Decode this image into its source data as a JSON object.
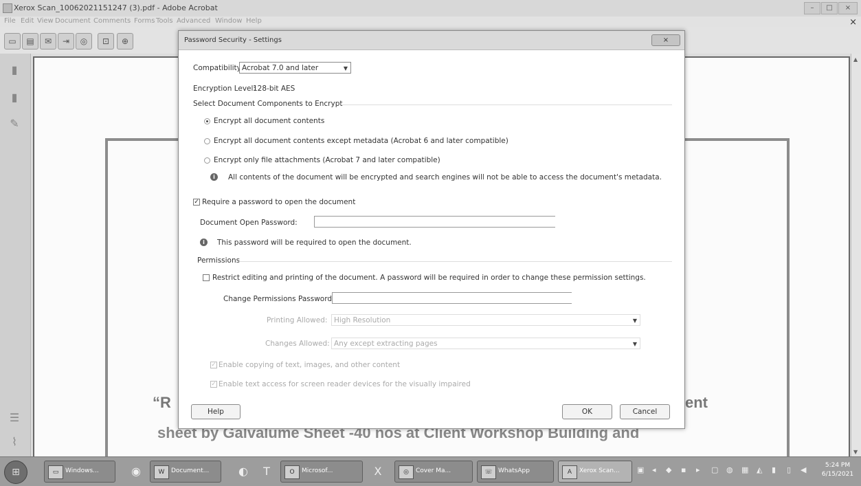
{
  "window": {
    "title": "Xerox Scan_10062021151247 (3).pdf - Adobe Acrobat",
    "menu": [
      "File",
      "Edit",
      "View",
      "Document",
      "Comments",
      "Forms",
      "Tools",
      "Advanced",
      "Window",
      "Help"
    ],
    "min_label": "–",
    "max_label": "□",
    "close_label": "×",
    "menu_close": "×"
  },
  "toolbar_icons": [
    "open-folder-icon",
    "print-icon",
    "email-icon",
    "export-icon",
    "search-icon",
    "select-icon",
    "zoom-icon"
  ],
  "document_bg": {
    "line1_start": "“R",
    "line1_end": "ent",
    "line2": "sheet by Galvalume Sheet -40 nos at Client Workshop Building and"
  },
  "dialog": {
    "title": "Password Security - Settings",
    "close_label": "×",
    "compatibility_label": "Compatibility:",
    "compatibility_value": "Acrobat 7.0 and later",
    "encryption_level_label": "Encryption Level:",
    "encryption_level_value": "128-bit AES",
    "components_heading": "Select Document Components to Encrypt",
    "radio_options": [
      "Encrypt all document contents",
      "Encrypt all document contents except metadata (Acrobat 6 and later compatible)",
      "Encrypt only file attachments (Acrobat 7 and later compatible)"
    ],
    "selected_option": 0,
    "info_encrypt": "All contents of the document will be encrypted and search engines will not be able to access the document's metadata.",
    "require_open_label": "Require a password to open the document",
    "require_open_checked": true,
    "open_password_label": "Document Open Password:",
    "open_password_value": "",
    "info_open": "This password will be required to open the document.",
    "permissions_heading": "Permissions",
    "restrict_label": "Restrict editing and printing of the document. A password will be required in order to change these permission settings.",
    "restrict_checked": false,
    "change_password_label": "Change Permissions Password:",
    "change_password_value": "",
    "printing_label": "Printing Allowed:",
    "printing_value": "High Resolution",
    "changes_label": "Changes Allowed:",
    "changes_value": "Any except extracting pages",
    "enable_copy_label": "Enable copying of text, images, and other content",
    "enable_reader_label": "Enable text access for screen reader devices for the visually impaired",
    "help_button": "Help",
    "ok_button": "OK",
    "cancel_button": "Cancel"
  },
  "taskbar": {
    "start_label": "⊞",
    "tasks": [
      "Windows...",
      "Document...",
      "Microsof...",
      "Cover Ma...",
      "WhatsApp",
      "Xerox Scan..."
    ],
    "clock_time": "5:24 PM",
    "clock_date": "6/15/2021"
  }
}
